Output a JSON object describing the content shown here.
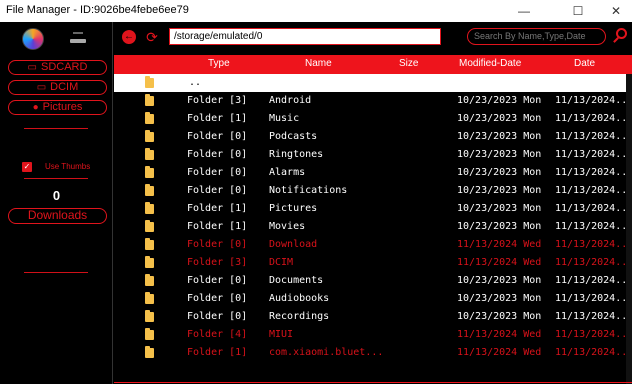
{
  "window": {
    "title": "File Manager - ID:9026be4febe6ee79",
    "minimize": "—",
    "maximize": "☐",
    "close": "✕"
  },
  "sidebar": {
    "buttons": [
      {
        "label": "SDCARD",
        "icon": "sdcard-icon",
        "glyph": "▭"
      },
      {
        "label": "DCIM",
        "icon": "image-icon",
        "glyph": "▭"
      },
      {
        "label": "Pictures",
        "icon": "person-icon",
        "glyph": "●"
      }
    ],
    "use_thumbs_label": "Use Thumbs",
    "use_thumbs_checked": true,
    "count": "0",
    "downloads_label": "Downloads"
  },
  "toolbar": {
    "path_value": "/storage/emulated/0",
    "search_placeholder": "Search By Name,Type,Date"
  },
  "table": {
    "headers": {
      "type": "Type",
      "name": "Name",
      "size": "Size",
      "modified": "Modified-Date",
      "date": "Date"
    },
    "parent_name": "..",
    "rows": [
      {
        "type": "Folder [3]",
        "name": "Android",
        "modified": "10/23/2023 Mon",
        "date": "11/13/2024...",
        "highlight": false
      },
      {
        "type": "Folder [1]",
        "name": "Music",
        "modified": "10/23/2023 Mon",
        "date": "11/13/2024...",
        "highlight": false
      },
      {
        "type": "Folder [0]",
        "name": "Podcasts",
        "modified": "10/23/2023 Mon",
        "date": "11/13/2024...",
        "highlight": false
      },
      {
        "type": "Folder [0]",
        "name": "Ringtones",
        "modified": "10/23/2023 Mon",
        "date": "11/13/2024...",
        "highlight": false
      },
      {
        "type": "Folder [0]",
        "name": "Alarms",
        "modified": "10/23/2023 Mon",
        "date": "11/13/2024...",
        "highlight": false
      },
      {
        "type": "Folder [0]",
        "name": "Notifications",
        "modified": "10/23/2023 Mon",
        "date": "11/13/2024...",
        "highlight": false
      },
      {
        "type": "Folder [1]",
        "name": "Pictures",
        "modified": "10/23/2023 Mon",
        "date": "11/13/2024...",
        "highlight": false
      },
      {
        "type": "Folder [1]",
        "name": "Movies",
        "modified": "10/23/2023 Mon",
        "date": "11/13/2024...",
        "highlight": false
      },
      {
        "type": "Folder [0]",
        "name": "Download",
        "modified": "11/13/2024 Wed",
        "date": "11/13/2024...",
        "highlight": true
      },
      {
        "type": "Folder [3]",
        "name": "DCIM",
        "modified": "11/13/2024 Wed",
        "date": "11/13/2024...",
        "highlight": true
      },
      {
        "type": "Folder [0]",
        "name": "Documents",
        "modified": "10/23/2023 Mon",
        "date": "11/13/2024...",
        "highlight": false
      },
      {
        "type": "Folder [0]",
        "name": "Audiobooks",
        "modified": "10/23/2023 Mon",
        "date": "11/13/2024...",
        "highlight": false
      },
      {
        "type": "Folder [0]",
        "name": "Recordings",
        "modified": "10/23/2023 Mon",
        "date": "11/13/2024...",
        "highlight": false
      },
      {
        "type": "Folder [4]",
        "name": "MIUI",
        "modified": "11/13/2024 Wed",
        "date": "11/13/2024...",
        "highlight": true
      },
      {
        "type": "Folder [1]",
        "name": "com.xiaomi.bluet...",
        "modified": "11/13/2024 Wed",
        "date": "11/13/2024...",
        "highlight": true
      }
    ]
  },
  "colors": {
    "accent": "#ee141c",
    "background": "#000000",
    "folder": "#f5c04a"
  }
}
